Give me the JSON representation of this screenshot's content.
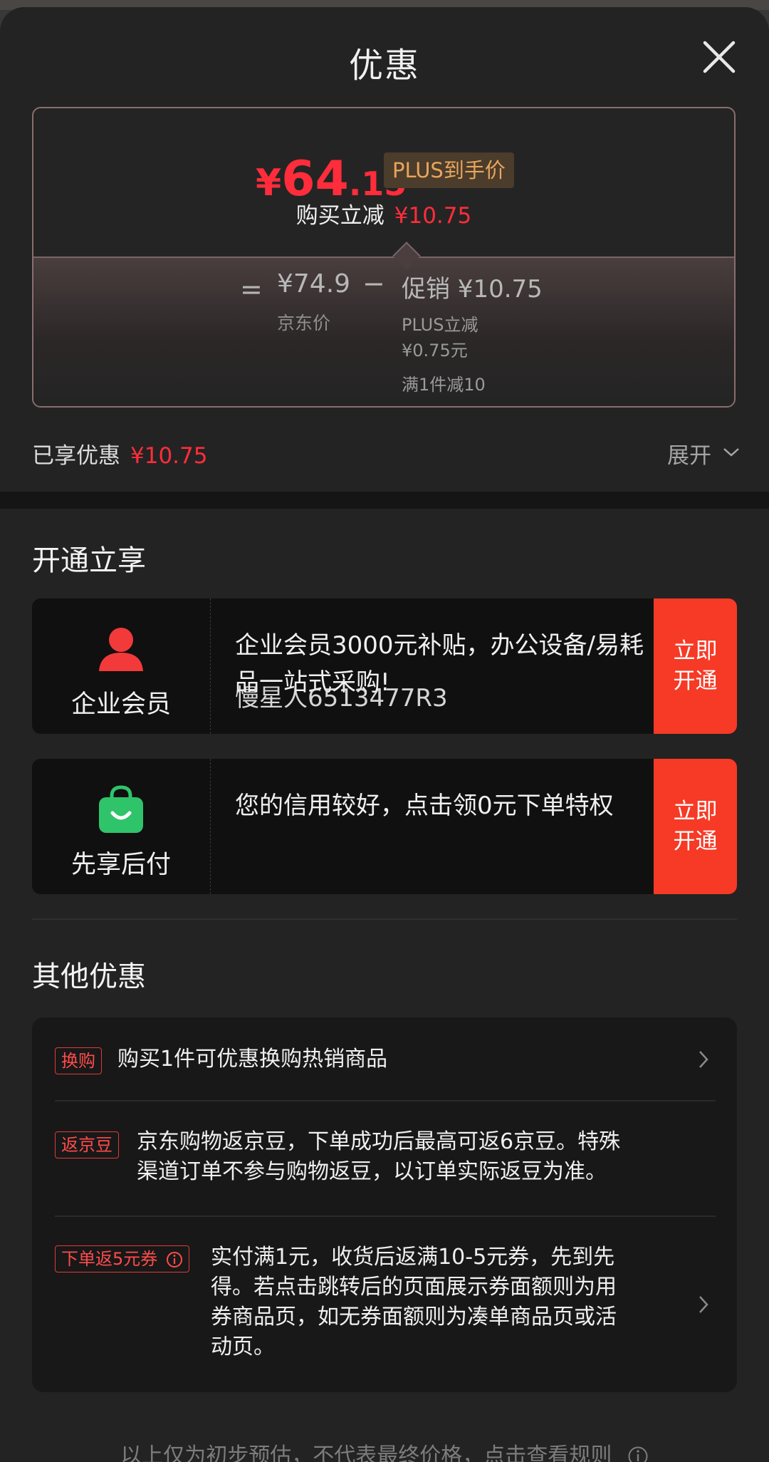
{
  "header": {
    "title": "优惠"
  },
  "price_card": {
    "currency": "¥",
    "final_integer": "64",
    "final_decimal": ".15",
    "plus_tag": "PLUS到手价",
    "instant_label": "购买立减",
    "instant_value": "¥10.75",
    "equals": "=",
    "jd_price": "¥74.9",
    "jd_price_label": "京东价",
    "minus": "−",
    "promo_title": "促销 ¥10.75",
    "promo_line1": "PLUS立减",
    "promo_line2": "¥0.75元",
    "promo_line3": "满1件减10"
  },
  "enjoyed": {
    "label": "已享优惠",
    "value": "¥10.75",
    "expand": "展开"
  },
  "open_section": {
    "title": "开通立享",
    "cards": [
      {
        "name": "企业会员",
        "description": "企业会员3000元补贴，办公设备/易耗品一站式采购!",
        "watermark": "慢星人6513477R3",
        "button_line1": "立即",
        "button_line2": "开通",
        "icon": "person-icon",
        "icon_color": "#f23a3a"
      },
      {
        "name": "先享后付",
        "description": "您的信用较好，点击领0元下单特权",
        "button_line1": "立即",
        "button_line2": "开通",
        "icon": "shopping-bag-icon",
        "icon_color": "#2fc46a"
      }
    ]
  },
  "other_section": {
    "title": "其他优惠",
    "items": [
      {
        "tag": "换购",
        "text": "购买1件可优惠换购热销商品"
      },
      {
        "tag": "返京豆",
        "text_line1": "京东购物返京豆，下单成功后最高可返6京豆。特殊",
        "text_line2": "渠道订单不参与购物返豆，以订单实际返豆为准。"
      },
      {
        "tag": "下单返5元券",
        "text_line1": "实付满1元，收货后返满10-5元券，先到先",
        "text_line2": "得。若点击跳转后的页面展示券面额则为用",
        "text_line3": "券商品页，如无券面额则为凑单商品页或活",
        "text_line4": "动页。"
      }
    ]
  },
  "footer": {
    "text": "以上仅为初步预估，不代表最终价格，点击查看规则"
  },
  "colors": {
    "accent_red": "#ff2d3b",
    "button_red": "#f63a26",
    "plus_gold": "#e8a55a",
    "background": "#232323"
  }
}
